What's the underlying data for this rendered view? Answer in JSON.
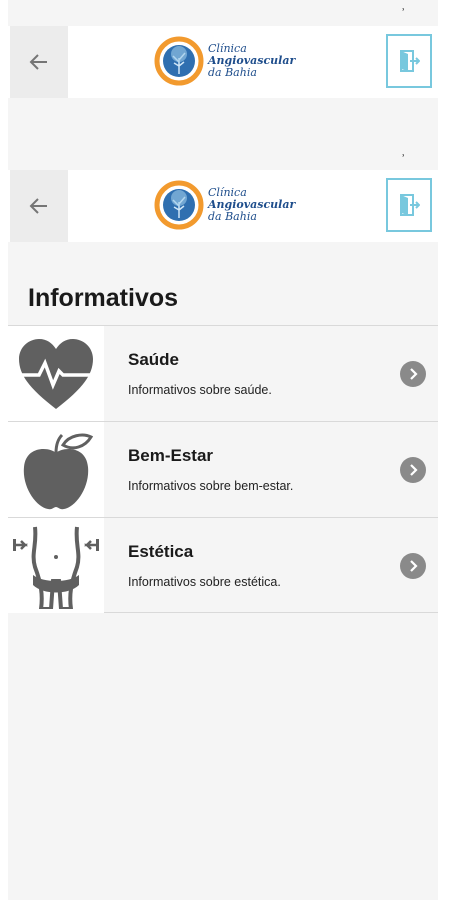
{
  "header": {
    "logo_line1": "Clínica",
    "logo_line2": "Angiovascular",
    "logo_line3": "da Bahia",
    "accent": "#78c8de",
    "logo_blue": "#1f4e8c",
    "logo_orange": "#f29a2e"
  },
  "main": {
    "title": "Informativos",
    "items": [
      {
        "title": "Saúde",
        "description": "Informativos sobre saúde.",
        "icon": "heart-pulse-icon"
      },
      {
        "title": "Bem-Estar",
        "description": "Informativos sobre bem-estar.",
        "icon": "apple-icon"
      },
      {
        "title": "Estética",
        "description": "Informativos sobre estética.",
        "icon": "waist-icon"
      }
    ]
  },
  "icons": {
    "back": "arrow-left-icon",
    "exit": "exit-door-icon",
    "chevron": "chevron-right-icon"
  }
}
